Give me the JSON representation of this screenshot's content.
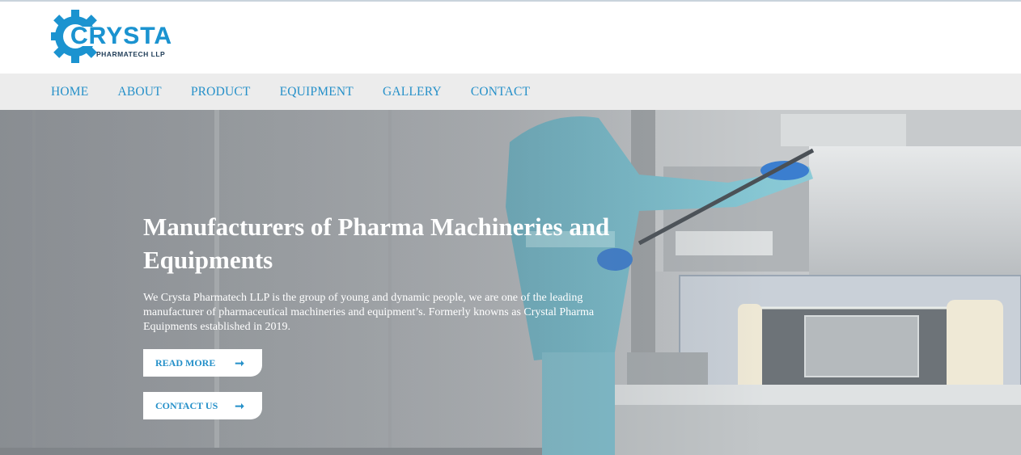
{
  "brand": {
    "name": "CRYSTA",
    "subtitle": "PHARMATECH LLP",
    "accent_color": "#1b93d0",
    "dark_color": "#1f3c57"
  },
  "nav": {
    "items": [
      {
        "label": "HOME"
      },
      {
        "label": "ABOUT"
      },
      {
        "label": "PRODUCT"
      },
      {
        "label": "EQUIPMENT"
      },
      {
        "label": "GALLERY"
      },
      {
        "label": "CONTACT"
      }
    ]
  },
  "hero": {
    "title": "Manufacturers of Pharma Machineries and Equipments",
    "description": "We Crysta Pharmatech LLP is the group of young and dynamic people, we are one of the leading manufacturer of pharmaceutical machineries and equipment’s. Formerly knowns as Crystal Pharma Equipments established in 2019.",
    "buttons": {
      "read_more": {
        "label": "READ MORE",
        "icon": "arrow-right-icon"
      },
      "contact_us": {
        "label": "CONTACT US",
        "icon": "arrow-right-icon"
      }
    }
  }
}
